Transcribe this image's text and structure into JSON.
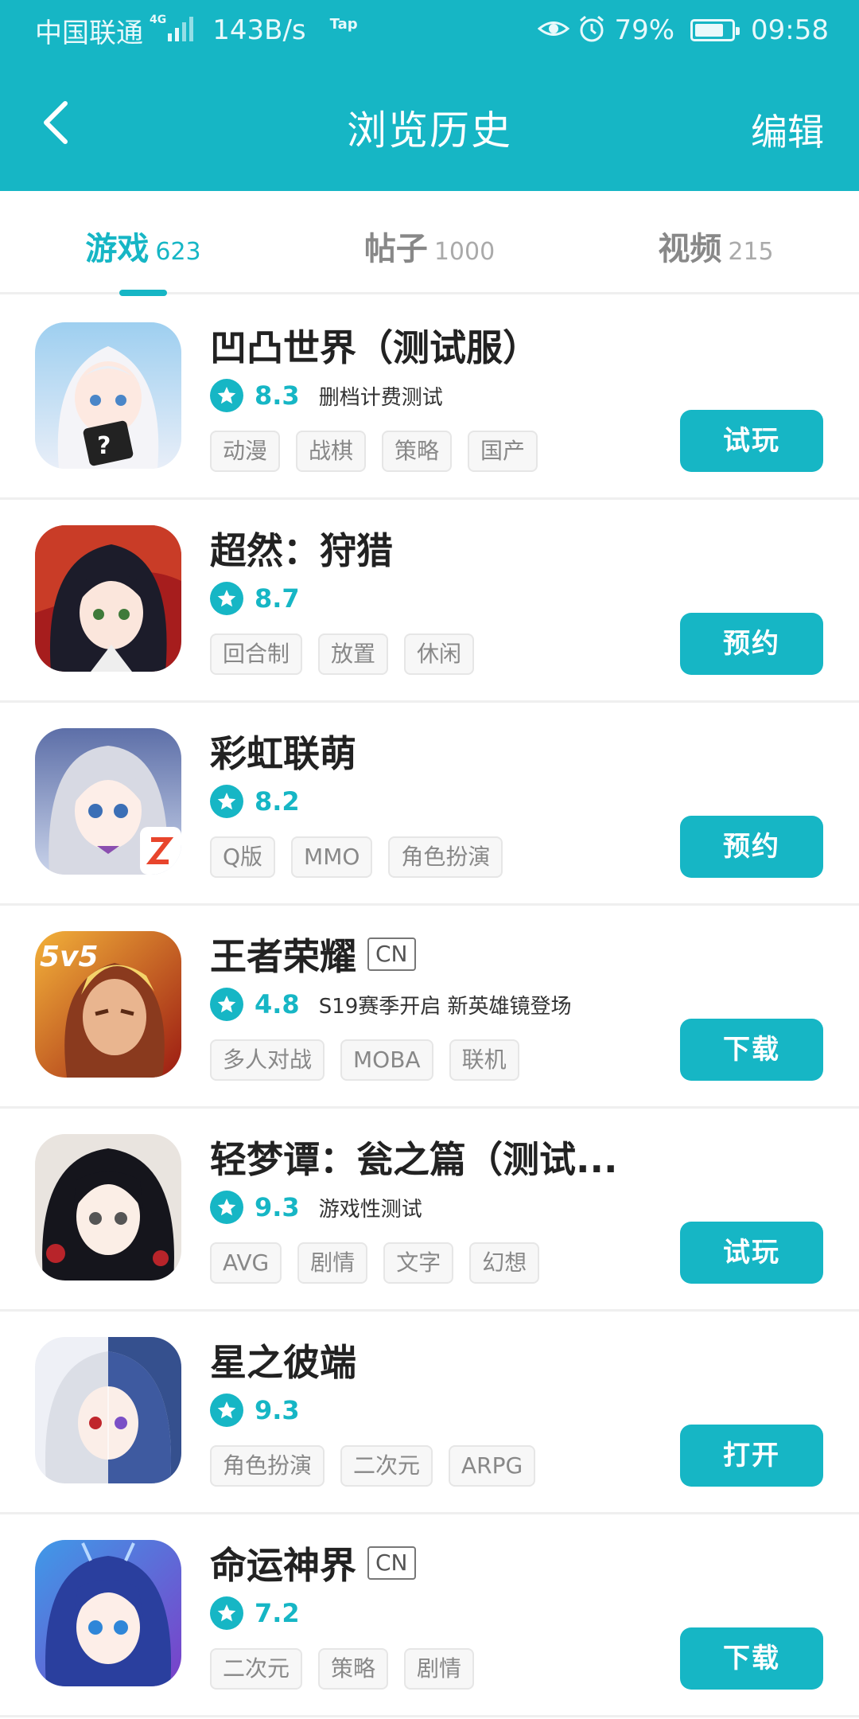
{
  "status_bar": {
    "carrier": "中国联通",
    "network": "4G",
    "speed": "143B/s",
    "tap": "Tap",
    "battery_pct": "79%",
    "battery_level": 0.79,
    "time": "09:58",
    "icons": [
      "eye-icon",
      "alarm-icon",
      "battery-icon",
      "signal-icon"
    ]
  },
  "header": {
    "title": "浏览历史",
    "edit_label": "编辑",
    "back_icon": "back-arrow-icon"
  },
  "tabs": [
    {
      "label": "游戏",
      "count": "623",
      "active": true
    },
    {
      "label": "帖子",
      "count": "1000",
      "active": false
    },
    {
      "label": "视频",
      "count": "215",
      "active": false
    }
  ],
  "games": [
    {
      "name": "凹凸世界（测试服）",
      "badge": "",
      "rating": "8.3",
      "note": "删档计费测试",
      "tags": [
        "动漫",
        "战棋",
        "策略",
        "国产"
      ],
      "action": "试玩"
    },
    {
      "name": "超然：狩猎",
      "badge": "",
      "rating": "8.7",
      "note": "",
      "tags": [
        "回合制",
        "放置",
        "休闲"
      ],
      "action": "预约"
    },
    {
      "name": "彩虹联萌",
      "badge": "",
      "rating": "8.2",
      "note": "",
      "tags": [
        "Q版",
        "MMO",
        "角色扮演"
      ],
      "action": "预约"
    },
    {
      "name": "王者荣耀",
      "badge": "CN",
      "rating": "4.8",
      "note": "S19赛季开启 新英雄镜登场",
      "tags": [
        "多人对战",
        "MOBA",
        "联机"
      ],
      "action": "下载"
    },
    {
      "name": "轻梦谭：瓮之篇（测试...",
      "badge": "",
      "rating": "9.3",
      "note": "游戏性测试",
      "tags": [
        "AVG",
        "剧情",
        "文字",
        "幻想"
      ],
      "action": "试玩"
    },
    {
      "name": "星之彼端",
      "badge": "",
      "rating": "9.3",
      "note": "",
      "tags": [
        "角色扮演",
        "二次元",
        "ARPG"
      ],
      "action": "打开"
    },
    {
      "name": "命运神界",
      "badge": "CN",
      "rating": "7.2",
      "note": "",
      "tags": [
        "二次元",
        "策略",
        "剧情"
      ],
      "action": "下载"
    }
  ],
  "colors": {
    "accent": "#16b6c5",
    "header_bg": "#16b6c5",
    "text": "#222222",
    "tag_text": "#888888"
  }
}
